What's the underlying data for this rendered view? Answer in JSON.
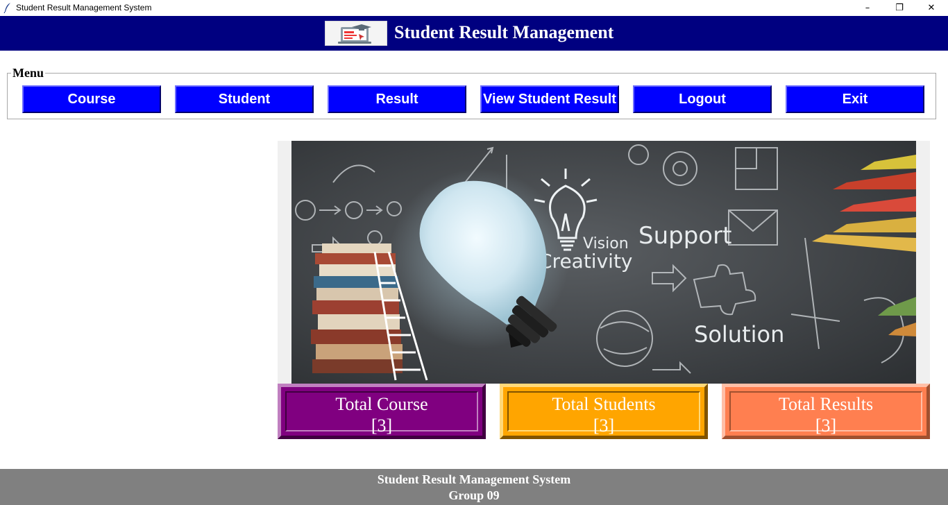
{
  "window": {
    "title": "Student Result Management System",
    "icon": "feather-icon",
    "controls": {
      "minimize": "–",
      "restore": "❐",
      "close": "✕"
    }
  },
  "header": {
    "title": "Student Result Management",
    "logo_icon": "graduation-laptop-icon",
    "background": "#000080"
  },
  "menu": {
    "legend": "Menu",
    "buttons": [
      {
        "label": "Course"
      },
      {
        "label": "Student"
      },
      {
        "label": "Result"
      },
      {
        "label": "View Student Result"
      },
      {
        "label": "Logout"
      },
      {
        "label": "Exit"
      }
    ],
    "button_color": "#0000ff"
  },
  "hero": {
    "texts": {
      "vision": "Vision",
      "creativity": "Creativity",
      "support": "Support",
      "solution": "Solution"
    }
  },
  "stats": {
    "course": {
      "label": "Total Course",
      "value": "[3]",
      "color": "#800080"
    },
    "students": {
      "label": "Total Students",
      "value": "[3]",
      "color": "#ffa500"
    },
    "results": {
      "label": "Total Results",
      "value": "[3]",
      "color": "#ff7f50"
    }
  },
  "footer": {
    "line1": "Student Result Management System",
    "line2": "Group 09",
    "background": "#808080"
  }
}
